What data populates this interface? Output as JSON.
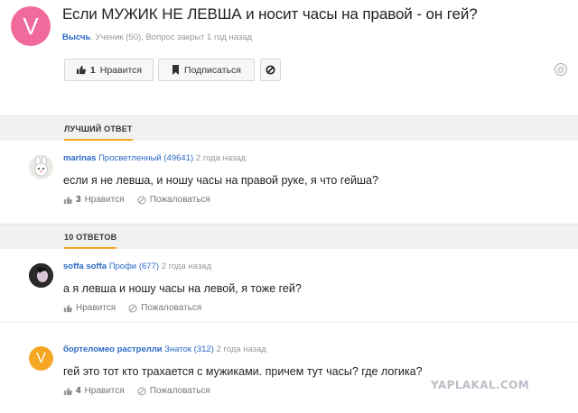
{
  "question": {
    "avatar_letter": "V",
    "avatar_color": "#f06a9c",
    "title": "Если МУЖИК НЕ ЛЕВША и носит часы на правой - он гей?",
    "author": "Высчь",
    "meta": ". Ученик (50), Вопрос закрыт 1 год назад",
    "like_count": "1",
    "like_label": "Нравится",
    "subscribe_label": "Подписаться"
  },
  "sections": {
    "best_answer": "ЛУЧШИЙ ОТВЕТ",
    "answers_count": "10 ОТВЕТОВ"
  },
  "answers": [
    {
      "nick": "marinas",
      "rank": "Просветленный (49641)",
      "time": "2 года назад",
      "text": "если я не левша, и ношу часы на правой руке, я что гейша?",
      "likes": "3",
      "like_label": "Нравится",
      "report_label": "Пожаловаться"
    },
    {
      "nick": "soffa soffa",
      "rank": "Профи (677)",
      "time": "2 года назад",
      "text": "а я левша и ношу часы на левой, я тоже гей?",
      "likes": "",
      "like_label": "Нравится",
      "report_label": "Пожаловаться"
    },
    {
      "nick": "бортеломео растрелли",
      "rank": "Знаток (312)",
      "time": "2 года назад",
      "text": "гей это тот кто трахается с мужиками. причем тут часы? где логика?",
      "likes": "4",
      "like_label": "Нравится",
      "report_label": "Пожаловаться",
      "avatar_letter": "V",
      "avatar_color": "#f5a623"
    }
  ],
  "watermark": "YAPLAKAL.COM",
  "accent_color": "#f5a623",
  "link_color": "#2a6ac7"
}
